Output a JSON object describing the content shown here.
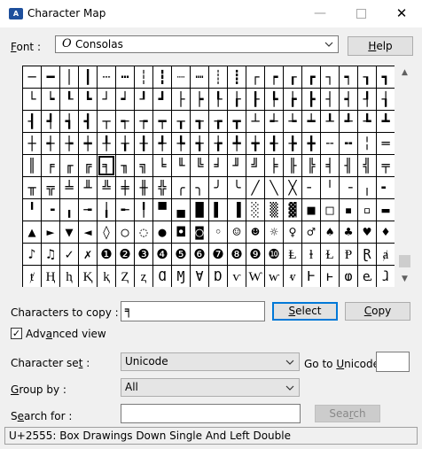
{
  "window": {
    "title": "Character Map",
    "minimize_glyph": "—",
    "close_glyph": "✕"
  },
  "font": {
    "label_u": "F",
    "label_rest": "ont :",
    "value": "Consolas",
    "glyph": "O",
    "help_u": "H",
    "help_rest": "elp"
  },
  "grid": {
    "rows": [
      [
        "─",
        "━",
        "│",
        "┃",
        "┄",
        "┅",
        "┆",
        "┇",
        "┈",
        "┉",
        "┊",
        "┋",
        "┌",
        "┍",
        "┎",
        "┏",
        "┐",
        "┑",
        "┒",
        "┓"
      ],
      [
        "└",
        "┕",
        "┖",
        "┗",
        "┘",
        "┙",
        "┚",
        "┛",
        "├",
        "┝",
        "┞",
        "┟",
        "┠",
        "┡",
        "┢",
        "┣",
        "┤",
        "┥",
        "┦",
        "┧"
      ],
      [
        "┨",
        "┩",
        "┪",
        "┫",
        "┬",
        "┭",
        "┮",
        "┯",
        "┰",
        "┱",
        "┲",
        "┳",
        "┴",
        "┵",
        "┶",
        "┷",
        "┸",
        "┹",
        "┺",
        "┻"
      ],
      [
        "┼",
        "┽",
        "┾",
        "┿",
        "╀",
        "╁",
        "╂",
        "╃",
        "╄",
        "╅",
        "╆",
        "╇",
        "╈",
        "╉",
        "╊",
        "╋",
        "╌",
        "╍",
        "╎",
        "═"
      ],
      [
        "║",
        "╒",
        "╓",
        "╔",
        "╕",
        "╖",
        "╗",
        "╘",
        "╙",
        "╚",
        "╛",
        "╜",
        "╝",
        "╞",
        "╟",
        "╠",
        "╡",
        "╢",
        "╣",
        "╤"
      ],
      [
        "╥",
        "╦",
        "╧",
        "╨",
        "╩",
        "╪",
        "╫",
        "╬",
        "╭",
        "╮",
        "╯",
        "╰",
        "╱",
        "╲",
        "╳",
        "╴",
        "╵",
        "╶",
        "╷",
        "╸"
      ],
      [
        "╹",
        "╺",
        "╻",
        "╼",
        "╽",
        "╾",
        "╿",
        "▀",
        "▄",
        "█",
        "▌",
        "▐",
        "░",
        "▒",
        "▓",
        "■",
        "□",
        "▪",
        "▫",
        "▬"
      ],
      [
        "▲",
        "►",
        "▼",
        "◄",
        "◊",
        "○",
        "◌",
        "●",
        "◘",
        "◙",
        "◦",
        "☺",
        "☻",
        "☼",
        "♀",
        "♂",
        "♠",
        "♣",
        "♥",
        "♦"
      ],
      [
        "♪",
        "♫",
        "✓",
        "✗",
        "❶",
        "❷",
        "❸",
        "❹",
        "❺",
        "❻",
        "❼",
        "❽",
        "❾",
        "❿",
        "Ⱡ",
        "ⱡ",
        "Ɫ",
        "Ᵽ",
        "Ɽ",
        "ⱥ"
      ],
      [
        "ⱦ",
        "Ⱨ",
        "ⱨ",
        "Ⱪ",
        "ⱪ",
        "Ⱬ",
        "ⱬ",
        "Ɑ",
        "Ɱ",
        "Ɐ",
        "Ɒ",
        "ⱱ",
        "Ⱳ",
        "ⱳ",
        "ⱴ",
        "Ⱶ",
        "ⱶ",
        "ⱷ",
        "ⱸ",
        "ⱹ"
      ]
    ],
    "selected": "╕"
  },
  "scroll": {
    "up": "▲",
    "down": "▼"
  },
  "copy": {
    "label": "Characters to copy :",
    "value": "╕",
    "select_u": "S",
    "select_rest": "elect",
    "copy_u": "C",
    "copy_rest": "opy"
  },
  "advanced": {
    "checked_glyph": "✓",
    "label_pre": "Adv",
    "label_u": "a",
    "label_post": "nced view"
  },
  "charset": {
    "label_pre": "Character se",
    "label_u": "t",
    "label_post": " :",
    "value": "Unicode",
    "goto_pre": "Go to ",
    "goto_u": "U",
    "goto_post": "nicode :",
    "goto_value": ""
  },
  "group": {
    "label_u": "G",
    "label_rest": "roup by :",
    "value": "All"
  },
  "search": {
    "label_pre": "S",
    "label_u": "e",
    "label_post": "arch for :",
    "value": "",
    "btn_pre": "Sea",
    "btn_u": "r",
    "btn_post": "ch"
  },
  "status": {
    "text": "U+2555: Box Drawings Down Single And Left Double"
  }
}
